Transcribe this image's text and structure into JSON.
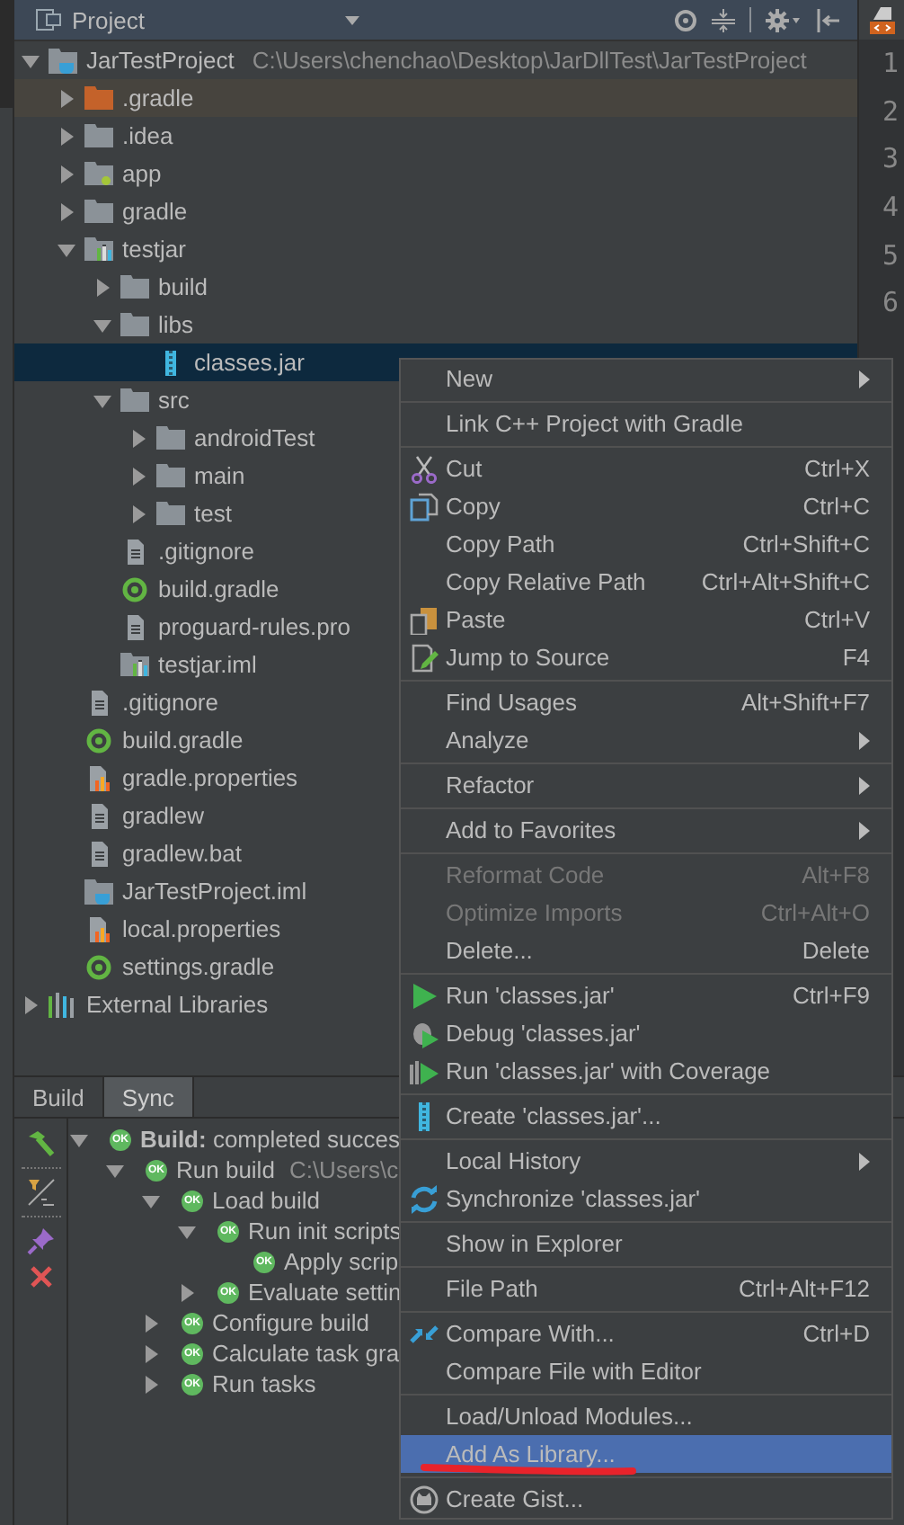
{
  "project_panel": {
    "title": "Project",
    "tree": [
      {
        "label": "JarTestProject",
        "path": "C:\\Users\\chenchao\\Desktop\\JarDllTest\\JarTestProject",
        "kind": "project",
        "expanded": true,
        "selected": false,
        "children": [
          {
            "label": ".gradle",
            "kind": "excluded-folder",
            "expanded": false,
            "selected": false
          },
          {
            "label": ".idea",
            "kind": "folder",
            "expanded": false,
            "selected": false
          },
          {
            "label": "app",
            "kind": "app-module",
            "expanded": false,
            "selected": false
          },
          {
            "label": "gradle",
            "kind": "folder",
            "expanded": false,
            "selected": false
          },
          {
            "label": "testjar",
            "kind": "module",
            "expanded": true,
            "selected": false,
            "children": [
              {
                "label": "build",
                "kind": "folder",
                "expanded": false,
                "selected": false
              },
              {
                "label": "libs",
                "kind": "folder",
                "expanded": true,
                "selected": false,
                "children": [
                  {
                    "label": "classes.jar",
                    "kind": "jar",
                    "selected": true
                  }
                ]
              },
              {
                "label": "src",
                "kind": "folder",
                "expanded": true,
                "selected": false,
                "children": [
                  {
                    "label": "androidTest",
                    "kind": "folder",
                    "expanded": false,
                    "selected": false
                  },
                  {
                    "label": "main",
                    "kind": "folder",
                    "expanded": false,
                    "selected": false
                  },
                  {
                    "label": "test",
                    "kind": "folder",
                    "expanded": false,
                    "selected": false
                  }
                ]
              },
              {
                "label": ".gitignore",
                "kind": "file",
                "selected": false
              },
              {
                "label": "build.gradle",
                "kind": "gradle",
                "selected": false
              },
              {
                "label": "proguard-rules.pro",
                "kind": "file",
                "selected": false
              },
              {
                "label": "testjar.iml",
                "kind": "module-file",
                "selected": false
              }
            ]
          },
          {
            "label": ".gitignore",
            "kind": "file",
            "selected": false
          },
          {
            "label": "build.gradle",
            "kind": "gradle",
            "selected": false
          },
          {
            "label": "gradle.properties",
            "kind": "properties",
            "selected": false
          },
          {
            "label": "gradlew",
            "kind": "file",
            "selected": false
          },
          {
            "label": "gradlew.bat",
            "kind": "file",
            "selected": false
          },
          {
            "label": "JarTestProject.iml",
            "kind": "project-file",
            "selected": false
          },
          {
            "label": "local.properties",
            "kind": "properties",
            "selected": false
          },
          {
            "label": "settings.gradle",
            "kind": "gradle",
            "selected": false
          }
        ]
      },
      {
        "label": "External Libraries",
        "kind": "libraries",
        "expanded": false,
        "selected": false
      }
    ]
  },
  "editor": {
    "line_numbers": [
      "1",
      "2",
      "3",
      "4",
      "5",
      "6"
    ]
  },
  "build_panel": {
    "tabs": [
      {
        "label": "Build",
        "selected": false
      },
      {
        "label": "Sync",
        "selected": true
      }
    ],
    "tree": [
      {
        "label": "**Build:** completed succes",
        "badge": "OK",
        "expanded": true,
        "children": [
          {
            "label": "Run build",
            "detail": "C:\\Users\\c",
            "badge": "OK",
            "expanded": true,
            "children": [
              {
                "label": "Load build",
                "badge": "OK",
                "expanded": true,
                "children": [
                  {
                    "label": "Run init scripts",
                    "badge": "OK",
                    "expanded": true,
                    "children": [
                      {
                        "label": "Apply scrip",
                        "badge": "OK"
                      }
                    ]
                  },
                  {
                    "label": "Evaluate settin",
                    "badge": "OK",
                    "expanded": false
                  }
                ]
              },
              {
                "label": "Configure build",
                "badge": "OK",
                "expanded": false
              },
              {
                "label": "Calculate task gra",
                "badge": "OK",
                "expanded": false
              },
              {
                "label": "Run tasks",
                "badge": "OK",
                "expanded": false
              }
            ]
          }
        ]
      }
    ]
  },
  "context_menu": {
    "items": [
      {
        "kind": "item",
        "label": "New",
        "submenu": true,
        "disabled": false,
        "selected": false
      },
      {
        "kind": "separator"
      },
      {
        "kind": "item",
        "label": "Link C++ Project with Gradle",
        "disabled": false,
        "selected": false
      },
      {
        "kind": "separator"
      },
      {
        "kind": "item",
        "label": "Cut",
        "shortcut": "Ctrl+X",
        "disabled": false,
        "selected": false
      },
      {
        "kind": "item",
        "label": "Copy",
        "shortcut": "Ctrl+C",
        "disabled": false,
        "selected": false
      },
      {
        "kind": "item",
        "label": "Copy Path",
        "shortcut": "Ctrl+Shift+C",
        "disabled": false,
        "selected": false
      },
      {
        "kind": "item",
        "label": "Copy Relative Path",
        "shortcut": "Ctrl+Alt+Shift+C",
        "disabled": false,
        "selected": false
      },
      {
        "kind": "item",
        "label": "Paste",
        "shortcut": "Ctrl+V",
        "disabled": false,
        "selected": false
      },
      {
        "kind": "item",
        "label": "Jump to Source",
        "shortcut": "F4",
        "disabled": false,
        "selected": false
      },
      {
        "kind": "separator"
      },
      {
        "kind": "item",
        "label": "Find Usages",
        "shortcut": "Alt+Shift+F7",
        "disabled": false,
        "selected": false
      },
      {
        "kind": "item",
        "label": "Analyze",
        "submenu": true,
        "disabled": false,
        "selected": false
      },
      {
        "kind": "separator"
      },
      {
        "kind": "item",
        "label": "Refactor",
        "submenu": true,
        "disabled": false,
        "selected": false
      },
      {
        "kind": "separator"
      },
      {
        "kind": "item",
        "label": "Add to Favorites",
        "submenu": true,
        "disabled": false,
        "selected": false
      },
      {
        "kind": "separator"
      },
      {
        "kind": "item",
        "label": "Reformat Code",
        "shortcut": "Alt+F8",
        "disabled": true,
        "selected": false
      },
      {
        "kind": "item",
        "label": "Optimize Imports",
        "shortcut": "Ctrl+Alt+O",
        "disabled": true,
        "selected": false
      },
      {
        "kind": "item",
        "label": "Delete...",
        "shortcut": "Delete",
        "disabled": false,
        "selected": false
      },
      {
        "kind": "separator"
      },
      {
        "kind": "item",
        "label": "Run 'classes.jar'",
        "shortcut": "Ctrl+F9",
        "disabled": false,
        "selected": false
      },
      {
        "kind": "item",
        "label": "Debug 'classes.jar'",
        "disabled": false,
        "selected": false
      },
      {
        "kind": "item",
        "label": "Run 'classes.jar' with Coverage",
        "disabled": false,
        "selected": false
      },
      {
        "kind": "separator"
      },
      {
        "kind": "item",
        "label": "Create 'classes.jar'...",
        "disabled": false,
        "selected": false
      },
      {
        "kind": "separator"
      },
      {
        "kind": "item",
        "label": "Local History",
        "submenu": true,
        "disabled": false,
        "selected": false
      },
      {
        "kind": "item",
        "label": "Synchronize 'classes.jar'",
        "disabled": false,
        "selected": false
      },
      {
        "kind": "separator"
      },
      {
        "kind": "item",
        "label": "Show in Explorer",
        "disabled": false,
        "selected": false
      },
      {
        "kind": "separator"
      },
      {
        "kind": "item",
        "label": "File Path",
        "shortcut": "Ctrl+Alt+F12",
        "disabled": false,
        "selected": false
      },
      {
        "kind": "separator"
      },
      {
        "kind": "item",
        "label": "Compare With...",
        "shortcut": "Ctrl+D",
        "disabled": false,
        "selected": false
      },
      {
        "kind": "item",
        "label": "Compare File with Editor",
        "disabled": false,
        "selected": false
      },
      {
        "kind": "separator"
      },
      {
        "kind": "item",
        "label": "Load/Unload Modules...",
        "disabled": false,
        "selected": false
      },
      {
        "kind": "item",
        "label": "Add As Library...",
        "disabled": false,
        "selected": true
      },
      {
        "kind": "separator"
      },
      {
        "kind": "item",
        "label": "Create Gist...",
        "disabled": false,
        "selected": false
      }
    ]
  }
}
